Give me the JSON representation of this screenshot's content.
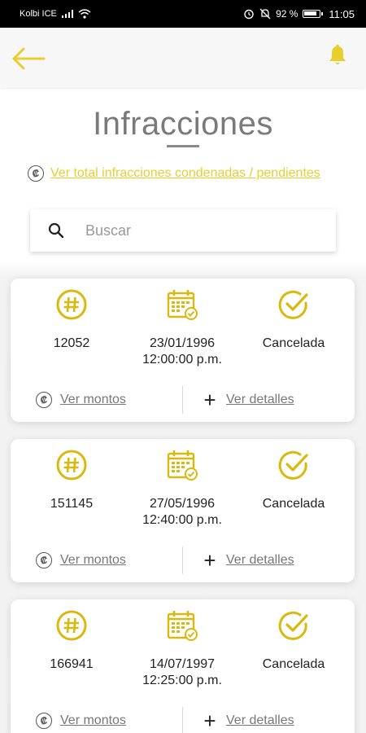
{
  "status_bar": {
    "carrier": "Kolbi ICE",
    "battery_percent": "92 %",
    "time": "11:05",
    "icons": [
      "signal-icon",
      "wifi-icon",
      "alarm-icon",
      "mute-icon",
      "battery-icon"
    ]
  },
  "app_bar": {
    "back_icon": "arrow-left-icon",
    "notification_icon": "bell-icon",
    "accent_color": "#e6cf2f"
  },
  "page": {
    "title": "Infracciones",
    "totals_link": "Ver total infracciones condenadas / pendientes",
    "totals_icon": "colon-currency-icon"
  },
  "search": {
    "placeholder": "Buscar",
    "value": ""
  },
  "infractions": [
    {
      "number": "12052",
      "date": "23/01/1996",
      "time": "12:00:00 p.m.",
      "status": "Cancelada",
      "amounts_label": "Ver montos",
      "details_label": "Ver detalles"
    },
    {
      "number": "151145",
      "date": "27/05/1996",
      "time": "12:40:00 p.m.",
      "status": "Cancelada",
      "amounts_label": "Ver montos",
      "details_label": "Ver detalles"
    },
    {
      "number": "166941",
      "date": "14/07/1997",
      "time": "12:25:00 p.m.",
      "status": "Cancelada",
      "amounts_label": "Ver montos",
      "details_label": "Ver detalles"
    }
  ]
}
